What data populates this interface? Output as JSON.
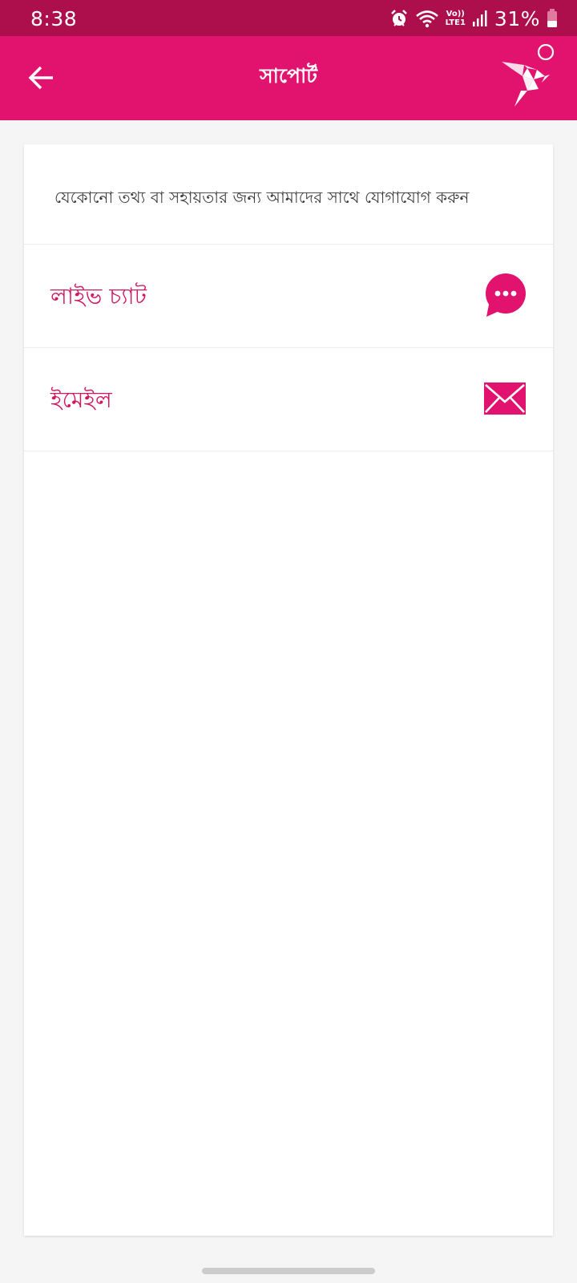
{
  "status_bar": {
    "time": "8:38",
    "network_label_top": "Vo))",
    "network_label_bottom": "LTE1",
    "battery_percent": "31%"
  },
  "app_bar": {
    "title": "সাপোর্ট"
  },
  "support": {
    "intro_text": "যেকোনো তথ্য বা সহায়তার জন্য আমাদের সাথে যোগাযোগ করুন",
    "options": [
      {
        "label": "লাইভ চ্যাট",
        "icon": "chat-bubble-icon"
      },
      {
        "label": "ইমেইল",
        "icon": "envelope-icon"
      }
    ]
  },
  "colors": {
    "status_bar": "#ad0f4c",
    "app_bar": "#e2136e",
    "accent_text": "#d0175f",
    "background": "#f5f5f5"
  }
}
